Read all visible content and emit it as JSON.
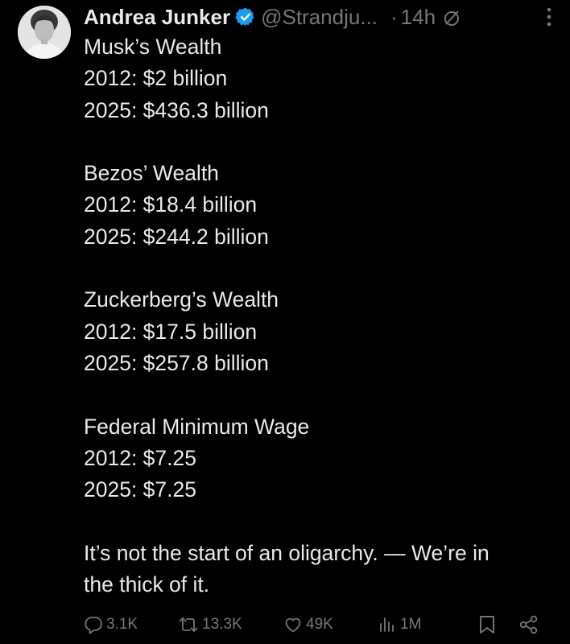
{
  "author": {
    "display_name": "Andrea Junker",
    "handle": "@Strandju...",
    "separator": "·",
    "time": "14h",
    "verified_color": "#1d9bf0"
  },
  "post": {
    "lines": [
      "Musk’s Wealth",
      "2012: $2 billion",
      "2025: $436.3 billion",
      "",
      "Bezos’ Wealth",
      "2012: $18.4 billion",
      "2025: $244.2 billion",
      "",
      "Zuckerberg’s Wealth",
      "2012: $17.5 billion",
      "2025: $257.8 billion",
      "",
      "Federal Minimum Wage",
      "2012: $7.25",
      "2025: $7.25",
      "",
      "It’s not the start of an oligarchy. — We’re in",
      "the thick of it."
    ]
  },
  "actions": {
    "replies": "3.1K",
    "reposts": "13.3K",
    "likes": "49K",
    "views": "1M",
    "icons": [
      "reply-icon",
      "repost-icon",
      "like-icon",
      "views-icon",
      "bookmark-icon",
      "share-icon"
    ]
  },
  "colors": {
    "background": "#000000",
    "text_primary": "#e7e9ea",
    "text_secondary": "#71767b"
  }
}
